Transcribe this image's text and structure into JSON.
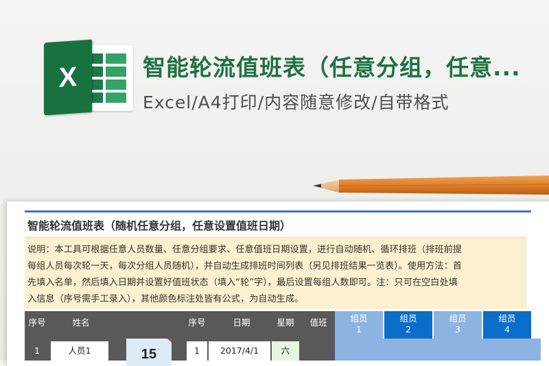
{
  "banner": {
    "logo_letter": "X",
    "title": "智能轮流值班表（任意分组，任意...",
    "subtitle": "Excel/A4打印/内容随意修改/自带格式"
  },
  "sheet": {
    "title": "智能轮流值班表（随机任意分组，任意设置值班日期）",
    "description_lines": [
      "说明：本工具可根据任意人员数量、任意分组要求、任意值班日期设置，进行自动随机、循环排班（排班前提",
      "每组人员每次轮一天，每次分组人员随机），并自动生成排班时间列表（另见排班结果一览表）。使用方法：首",
      "先填入名单，然后填入日期并设置好值班状态（填入“轮”字），最后设置每组人数即可。注：只可在空白处填",
      "入信息（序号需手工录入），其他颜色标注处皆有公式，为自动生成。"
    ],
    "headers": {
      "seq1": "序号",
      "name": "姓名",
      "seq2": "序号",
      "date": "日期",
      "weekday": "星期",
      "duty": "值班"
    },
    "groups": [
      {
        "label": "组员",
        "num": "1"
      },
      {
        "label": "组员",
        "num": "2"
      },
      {
        "label": "组员",
        "num": "3"
      },
      {
        "label": "组员",
        "num": "4"
      }
    ],
    "row1": {
      "seq1": "1",
      "name": "人员1",
      "calendar_day": "15",
      "seq2": "1",
      "date": "2017/4/1",
      "weekday": "六"
    }
  },
  "colors": {
    "title_green": "#1e7145",
    "header_gray": "#595959",
    "group_light": "#8db3e2",
    "group_dark": "#0a6ec9",
    "desc_bg": "#fbf0cf"
  }
}
